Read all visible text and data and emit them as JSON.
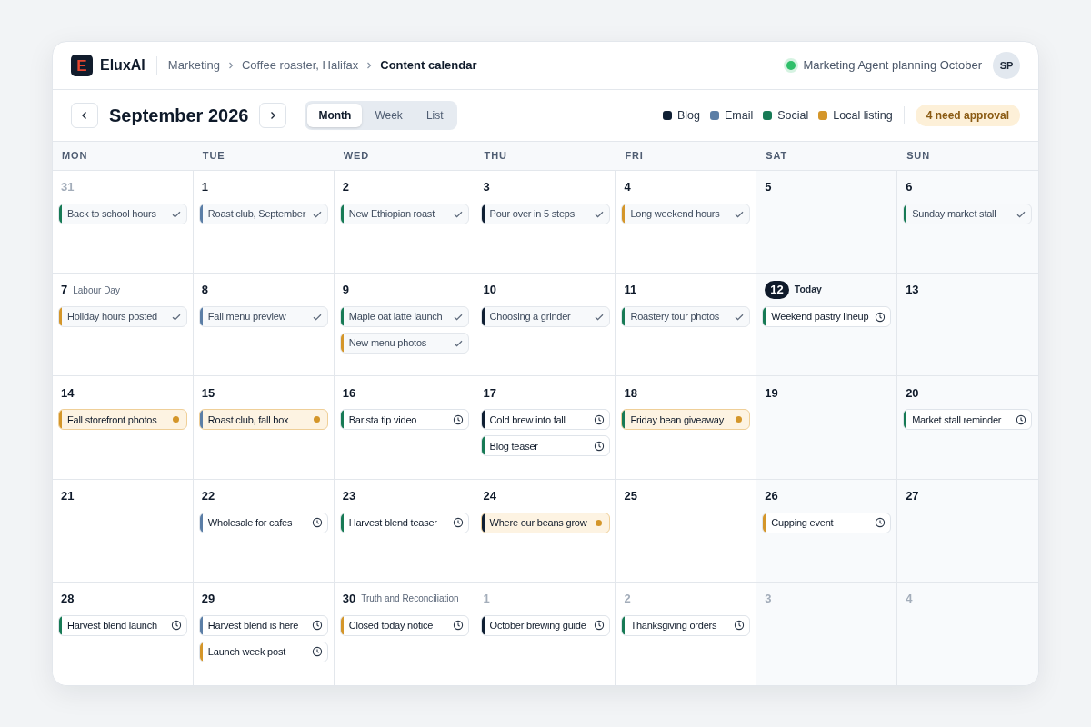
{
  "brand": {
    "name": "EluxAI",
    "mark": "E"
  },
  "breadcrumbs": [
    {
      "label": "Marketing",
      "current": false
    },
    {
      "label": "Coffee roaster, Halifax",
      "current": false
    },
    {
      "label": "Content calendar",
      "current": true
    }
  ],
  "agent_status": {
    "text": "Marketing Agent planning October",
    "active": true
  },
  "avatar": "SP",
  "month_title": "September 2026",
  "views": [
    {
      "label": "Month",
      "selected": true
    },
    {
      "label": "Week",
      "selected": false
    },
    {
      "label": "List",
      "selected": false
    }
  ],
  "legend": [
    {
      "label": "Blog",
      "color": "#0f1f33"
    },
    {
      "label": "Email",
      "color": "#5b7ea6"
    },
    {
      "label": "Social",
      "color": "#177a55"
    },
    {
      "label": "Local listing",
      "color": "#d4962a"
    }
  ],
  "approval_badge": "4 need approval",
  "weekdays": [
    "MON",
    "TUE",
    "WED",
    "THU",
    "FRI",
    "SAT",
    "SUN"
  ],
  "days": [
    {
      "day": "31",
      "in_month": false,
      "today": false,
      "events": [
        {
          "title": "Back to school hours",
          "color": "#177a55",
          "kind": "published"
        }
      ]
    },
    {
      "day": "1",
      "in_month": true,
      "today": false,
      "events": [
        {
          "title": "Roast club, September",
          "color": "#5b7ea6",
          "kind": "published"
        }
      ]
    },
    {
      "day": "2",
      "in_month": true,
      "today": false,
      "events": [
        {
          "title": "New Ethiopian roast",
          "color": "#177a55",
          "kind": "published"
        }
      ]
    },
    {
      "day": "3",
      "in_month": true,
      "today": false,
      "events": [
        {
          "title": "Pour over in 5 steps",
          "color": "#0f1f33",
          "kind": "published"
        }
      ]
    },
    {
      "day": "4",
      "in_month": true,
      "today": false,
      "events": [
        {
          "title": "Long weekend hours",
          "color": "#d4962a",
          "kind": "published"
        }
      ]
    },
    {
      "day": "5",
      "in_month": true,
      "today": false
    },
    {
      "day": "6",
      "in_month": true,
      "today": false,
      "events": [
        {
          "title": "Sunday market stall",
          "color": "#177a55",
          "kind": "published"
        }
      ]
    },
    {
      "day": "7",
      "in_month": true,
      "today": false,
      "holiday": "Labour Day",
      "events": [
        {
          "title": "Holiday hours posted",
          "color": "#d4962a",
          "kind": "published"
        }
      ]
    },
    {
      "day": "8",
      "in_month": true,
      "today": false,
      "events": [
        {
          "title": "Fall menu preview",
          "color": "#5b7ea6",
          "kind": "published"
        }
      ]
    },
    {
      "day": "9",
      "in_month": true,
      "today": false,
      "events": [
        {
          "title": "Maple oat latte launch",
          "color": "#177a55",
          "kind": "published"
        },
        {
          "title": "New menu photos",
          "color": "#d4962a",
          "kind": "published"
        }
      ]
    },
    {
      "day": "10",
      "in_month": true,
      "today": false,
      "events": [
        {
          "title": "Choosing a grinder",
          "color": "#0f1f33",
          "kind": "published"
        }
      ]
    },
    {
      "day": "11",
      "in_month": true,
      "today": false,
      "events": [
        {
          "title": "Roastery tour photos",
          "color": "#177a55",
          "kind": "published"
        }
      ]
    },
    {
      "day": "12",
      "in_month": true,
      "today": true,
      "today_label": "Today",
      "events": [
        {
          "title": "Weekend pastry lineup",
          "color": "#177a55",
          "kind": "scheduled"
        }
      ]
    },
    {
      "day": "13",
      "in_month": true,
      "today": false
    },
    {
      "day": "14",
      "in_month": true,
      "today": false,
      "events": [
        {
          "title": "Fall storefront photos",
          "color": "#d4962a",
          "kind": "approval"
        }
      ]
    },
    {
      "day": "15",
      "in_month": true,
      "today": false,
      "events": [
        {
          "title": "Roast club, fall box",
          "color": "#5b7ea6",
          "kind": "approval"
        }
      ]
    },
    {
      "day": "16",
      "in_month": true,
      "today": false,
      "events": [
        {
          "title": "Barista tip video",
          "color": "#177a55",
          "kind": "scheduled"
        }
      ]
    },
    {
      "day": "17",
      "in_month": true,
      "today": false,
      "events": [
        {
          "title": "Cold brew into fall",
          "color": "#0f1f33",
          "kind": "scheduled"
        },
        {
          "title": "Blog teaser",
          "color": "#177a55",
          "kind": "scheduled"
        }
      ]
    },
    {
      "day": "18",
      "in_month": true,
      "today": false,
      "events": [
        {
          "title": "Friday bean giveaway",
          "color": "#177a55",
          "kind": "approval"
        }
      ]
    },
    {
      "day": "19",
      "in_month": true,
      "today": false
    },
    {
      "day": "20",
      "in_month": true,
      "today": false,
      "events": [
        {
          "title": "Market stall reminder",
          "color": "#177a55",
          "kind": "scheduled"
        }
      ]
    },
    {
      "day": "21",
      "in_month": true,
      "today": false
    },
    {
      "day": "22",
      "in_month": true,
      "today": false,
      "events": [
        {
          "title": "Wholesale for cafes",
          "color": "#5b7ea6",
          "kind": "scheduled"
        }
      ]
    },
    {
      "day": "23",
      "in_month": true,
      "today": false,
      "events": [
        {
          "title": "Harvest blend teaser",
          "color": "#177a55",
          "kind": "scheduled"
        }
      ]
    },
    {
      "day": "24",
      "in_month": true,
      "today": false,
      "events": [
        {
          "title": "Where our beans grow",
          "color": "#0f1f33",
          "kind": "approval"
        }
      ]
    },
    {
      "day": "25",
      "in_month": true,
      "today": false
    },
    {
      "day": "26",
      "in_month": true,
      "today": false,
      "events": [
        {
          "title": "Cupping event",
          "color": "#d4962a",
          "kind": "scheduled"
        }
      ]
    },
    {
      "day": "27",
      "in_month": true,
      "today": false
    },
    {
      "day": "28",
      "in_month": true,
      "today": false,
      "events": [
        {
          "title": "Harvest blend launch",
          "color": "#177a55",
          "kind": "scheduled"
        }
      ]
    },
    {
      "day": "29",
      "in_month": true,
      "today": false,
      "events": [
        {
          "title": "Harvest blend is here",
          "color": "#5b7ea6",
          "kind": "scheduled"
        },
        {
          "title": "Launch week post",
          "color": "#d4962a",
          "kind": "scheduled"
        }
      ]
    },
    {
      "day": "30",
      "in_month": true,
      "today": false,
      "holiday": "Truth and Reconciliation",
      "events": [
        {
          "title": "Closed today notice",
          "color": "#d4962a",
          "kind": "scheduled"
        }
      ]
    },
    {
      "day": "1",
      "in_month": false,
      "today": false,
      "events": [
        {
          "title": "October brewing guide",
          "color": "#0f1f33",
          "kind": "scheduled"
        }
      ]
    },
    {
      "day": "2",
      "in_month": false,
      "today": false,
      "events": [
        {
          "title": "Thanksgiving orders",
          "color": "#177a55",
          "kind": "scheduled"
        }
      ]
    },
    {
      "day": "3",
      "in_month": false,
      "today": false
    },
    {
      "day": "4",
      "in_month": false,
      "today": false
    }
  ]
}
